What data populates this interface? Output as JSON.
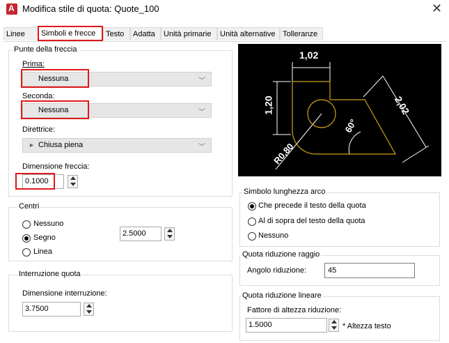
{
  "window": {
    "title": "Modifica stile di quota: Quote_100",
    "close_icon": "close-icon"
  },
  "tabs": [
    {
      "label": "Linee"
    },
    {
      "label": "Simboli e frecce",
      "active": true
    },
    {
      "label": "Testo"
    },
    {
      "label": "Adatta"
    },
    {
      "label": "Unità primarie"
    },
    {
      "label": "Unità alternative"
    },
    {
      "label": "Tolleranze"
    }
  ],
  "arrowheads": {
    "legend": "Punte della freccia",
    "first_label": "Prima:",
    "first_value": "Nessuna",
    "second_label": "Seconda:",
    "second_value": "Nessuna",
    "leader_label": "Direttrice:",
    "leader_value": "Chiusa piena",
    "size_label": "Dimensione freccia:",
    "size_value": "0.1000"
  },
  "center_marks": {
    "legend": "Centri",
    "options": [
      "Nessuno",
      "Segno",
      "Linea"
    ],
    "selected": "Segno",
    "size_value": "2.5000"
  },
  "dim_break": {
    "legend": "Interruzione quota",
    "size_label": "Dimensione interruzione:",
    "size_value": "3.7500"
  },
  "preview": {
    "dim_top": "1,02",
    "dim_left": "1,20",
    "dim_diag": "2,02",
    "angle": "60°",
    "radius": "R0,80"
  },
  "arc_length": {
    "legend": "Simbolo lunghezza arco",
    "options": [
      "Che precede il testo della quota",
      "Al di sopra del testo della quota",
      "Nessuno"
    ],
    "selected": "Che precede il testo della quota"
  },
  "radius_jog": {
    "legend": "Quota riduzione raggio",
    "angle_label": "Angolo riduzione:",
    "angle_value": "45"
  },
  "linear_jog": {
    "legend": "Quota riduzione lineare",
    "height_label": "Fattore di altezza riduzione:",
    "height_value": "1.5000",
    "suffix": "* Altezza testo"
  },
  "colors": {
    "highlight": "#e01818",
    "preview_bg": "#000000",
    "preview_line": "#ffffff",
    "preview_shape": "#d4a017"
  }
}
